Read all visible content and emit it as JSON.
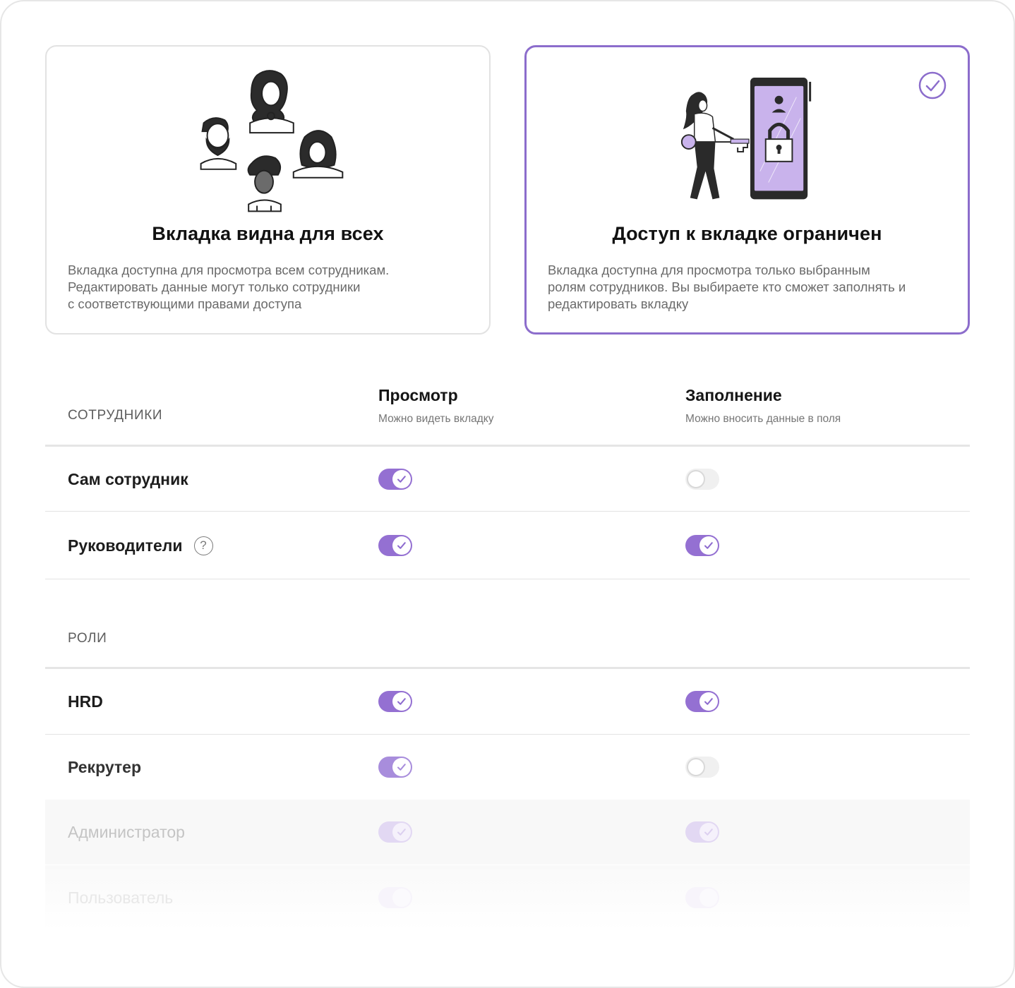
{
  "options": {
    "public": {
      "title": "Вкладка видна для всех",
      "description": "Вкладка доступна для просмотра всем сотрудникам.\nРедактировать данные могут только сотрудники\nс соответствующими  правами доступа",
      "selected": false,
      "illustration": "people-group-illustration"
    },
    "restricted": {
      "title": "Доступ к вкладке ограничен",
      "description": "Вкладка доступна для просмотра только выбранным\nролям сотрудников. Вы выбираете кто сможет заполнять и\nредактировать  вкладку",
      "selected": true,
      "illustration": "key-lock-phone-illustration"
    }
  },
  "table": {
    "columns": {
      "view": {
        "title": "Просмотр",
        "subtitle": "Можно видеть вкладку"
      },
      "fill": {
        "title": "Заполнение",
        "subtitle": "Можно вносить данные в поля"
      }
    },
    "employees_section": "СОТРУДНИКИ",
    "employees": [
      {
        "label": "Сам сотрудник",
        "view": true,
        "fill": false,
        "help": false
      },
      {
        "label": "Руководители",
        "view": true,
        "fill": true,
        "help": true
      }
    ],
    "roles_section": "РОЛИ",
    "roles": [
      {
        "label": "HRD",
        "view": true,
        "fill": true,
        "state": "normal"
      },
      {
        "label": "Рекрутер",
        "view": true,
        "fill": false,
        "state": "normal"
      },
      {
        "label": "Администратор",
        "view": true,
        "fill": true,
        "state": "disabled"
      },
      {
        "label": "Пользователь",
        "view": true,
        "fill": true,
        "state": "fading"
      }
    ]
  },
  "colors": {
    "accent": "#9470d2",
    "selected_border": "#8c6dcc",
    "illustration_fill": "#c9b3ec"
  }
}
